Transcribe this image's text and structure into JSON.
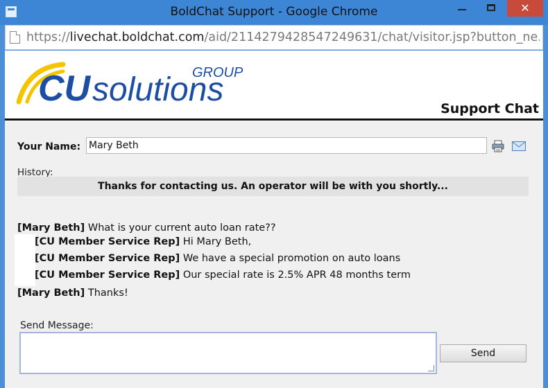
{
  "window": {
    "title": "BoldChat Support - Google Chrome",
    "close_glyph": "✕"
  },
  "address_bar": {
    "protocol": "https://",
    "host": "livechat.boldchat.com",
    "path": "/aid/2114279428547249631/chat/visitor.jsp?button_ne..."
  },
  "logo": {
    "cu": "CU",
    "solutions": "solutions",
    "group": "GROUP",
    "colors": {
      "blue": "#1c4fa3",
      "yellow": "#f5c400"
    }
  },
  "header": {
    "title": "Support Chat"
  },
  "form": {
    "name_label": "Your Name:",
    "name_value": "Mary Beth",
    "history_label": "History:",
    "send_label": "Send Message:",
    "send_button": "Send",
    "message_value": ""
  },
  "greeting": "Thanks for contacting us. An operator will be with you shortly...",
  "messages": [
    {
      "sender": "[Mary Beth]",
      "text": " What is your current auto loan rate??"
    },
    {
      "sender": "[CU Member Service Rep]",
      "text": " Hi Mary Beth,"
    },
    {
      "sender": "[CU Member Service Rep]",
      "text": " We have a special promotion on auto loans"
    },
    {
      "sender": "[CU Member Service Rep]",
      "text": " Our special rate is 2.5% APR 48 months term"
    },
    {
      "sender": "[Mary Beth]",
      "text": " Thanks!"
    }
  ]
}
